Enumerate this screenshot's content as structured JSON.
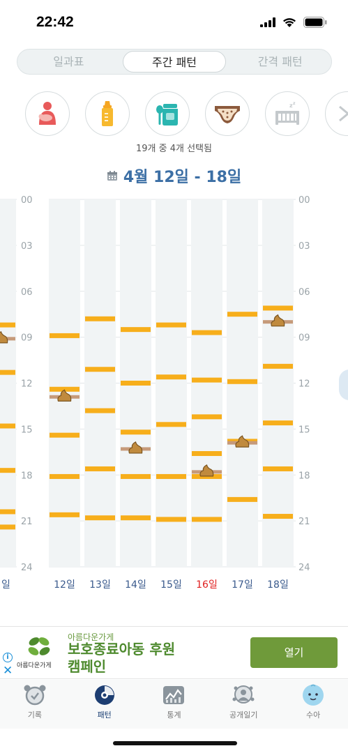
{
  "status": {
    "time": "22:42"
  },
  "tabs": [
    {
      "label": "일과표"
    },
    {
      "label": "주간 패턴"
    },
    {
      "label": "간격 패턴"
    }
  ],
  "categories": [
    {
      "icon": "breastfeeding-icon"
    },
    {
      "icon": "baby-bottle-icon"
    },
    {
      "icon": "baby-food-icon"
    },
    {
      "icon": "diaper-icon"
    },
    {
      "icon": "sleep-crib-icon"
    },
    {
      "icon": "next-category-icon"
    }
  ],
  "selected_count": "19개 중 4개 선택됨",
  "date_range": "4월 12일 - 18일",
  "colors": {
    "feeding": "#f7ae1b",
    "poop_line": "#c69a7a",
    "poop_icon": "#c08a3e",
    "weekday": "#3a5a8c",
    "sunday": "#e02020"
  },
  "chart_data": {
    "type": "timeline",
    "y_ticks": [
      "00",
      "03",
      "06",
      "09",
      "12",
      "15",
      "18",
      "21",
      "24"
    ],
    "ylim": [
      0,
      24
    ],
    "days": [
      {
        "label": "12일",
        "feed": [
          8.9,
          12.4,
          15.4,
          18.1,
          20.6
        ],
        "poop": [
          12.9
        ]
      },
      {
        "label": "13일",
        "feed": [
          7.8,
          11.1,
          13.8,
          17.6,
          20.8
        ],
        "poop": []
      },
      {
        "label": "14일",
        "feed": [
          8.5,
          12.0,
          15.2,
          18.1,
          20.8
        ],
        "poop": [
          16.3
        ]
      },
      {
        "label": "15일",
        "feed": [
          8.2,
          11.6,
          14.7,
          18.1,
          20.9
        ],
        "poop": []
      },
      {
        "label": "16일",
        "feed": [
          8.7,
          11.8,
          14.2,
          16.6,
          18.1,
          20.9
        ],
        "poop": [
          17.8
        ]
      },
      {
        "label": "17일",
        "feed": [
          7.5,
          11.9,
          15.8,
          19.6
        ],
        "poop": [
          15.9
        ]
      },
      {
        "label": "18일",
        "feed": [
          7.1,
          10.9,
          14.6,
          17.6,
          20.7
        ],
        "poop": [
          8.0
        ]
      }
    ],
    "prev_day": {
      "label": "일",
      "feed": [
        8.2,
        11.3,
        14.8,
        17.7,
        20.4,
        21.4
      ],
      "poop": [
        9.1
      ]
    },
    "sunday_label": "16일"
  },
  "ad": {
    "brand_small": "아름다운가게",
    "title_line1": "보호종료아동 후원",
    "title_line2": "캠페인",
    "logo_label": "아름다운가게",
    "open_label": "열기",
    "info_glyph": "i",
    "close_glyph": "✕"
  },
  "nav": [
    {
      "label": "기록",
      "icon": "alarm-clock-icon"
    },
    {
      "label": "패턴",
      "icon": "pattern-icon"
    },
    {
      "label": "통계",
      "icon": "stats-chart-icon"
    },
    {
      "label": "공개일기",
      "icon": "public-diary-icon"
    },
    {
      "label": "수아",
      "icon": "baby-profile-icon"
    }
  ]
}
